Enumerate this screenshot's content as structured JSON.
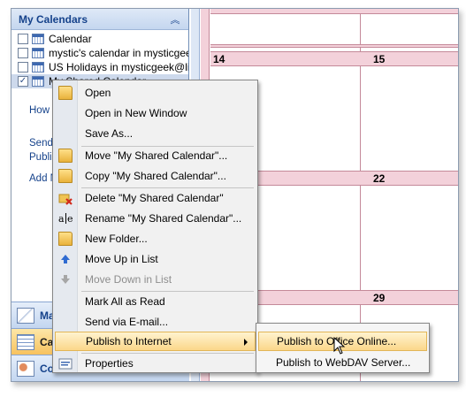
{
  "nav": {
    "header_title": "My Calendars",
    "calendars": [
      {
        "label": "Calendar",
        "checked": false
      },
      {
        "label": "mystic's calendar in mysticgeek",
        "checked": false
      },
      {
        "label": "US Holidays in mysticgeek@liv",
        "checked": false
      },
      {
        "label": "My Shared Calendar",
        "checked": true
      }
    ],
    "links": [
      "How t",
      "Send",
      "Publis",
      "Add N"
    ],
    "buttons": [
      {
        "label": "Ma",
        "icon": "mail-icon"
      },
      {
        "label": "Cale",
        "icon": "calendar-icon"
      },
      {
        "label": "Co",
        "icon": "contacts-icon"
      }
    ]
  },
  "grid": {
    "days": [
      "14",
      "15",
      "22",
      "29"
    ]
  },
  "context_menu": {
    "items": [
      {
        "label": "Open",
        "icon": "open-folder-icon"
      },
      {
        "label": "Open in New Window",
        "icon": ""
      },
      {
        "label": "Save As...",
        "icon": ""
      },
      {
        "label": "Move \"My Shared Calendar\"...",
        "icon": "move-folder-icon"
      },
      {
        "label": "Copy \"My Shared Calendar\"...",
        "icon": "copy-folder-icon"
      },
      {
        "label": "Delete \"My Shared Calendar\"",
        "icon": "delete-folder-icon"
      },
      {
        "label": "Rename \"My Shared Calendar\"...",
        "icon": "rename-icon"
      },
      {
        "label": "New Folder...",
        "icon": "new-folder-icon"
      },
      {
        "label": "Move Up in List",
        "icon": "arrow-up-icon"
      },
      {
        "label": "Move Down in List",
        "icon": "arrow-down-icon",
        "disabled": true
      },
      {
        "label": "Mark All as Read",
        "icon": ""
      },
      {
        "label": "Send via E-mail...",
        "icon": ""
      },
      {
        "label": "Publish to Internet",
        "icon": "",
        "submenu": true
      },
      {
        "label": "Properties",
        "icon": "properties-icon"
      }
    ]
  },
  "submenu": {
    "items": [
      {
        "label": "Publish to Office Online..."
      },
      {
        "label": "Publish to WebDAV Server..."
      }
    ]
  },
  "colors": {
    "accent": "#15428b",
    "calendar_header": "#f3d1da",
    "highlight": "#fbd78a"
  }
}
